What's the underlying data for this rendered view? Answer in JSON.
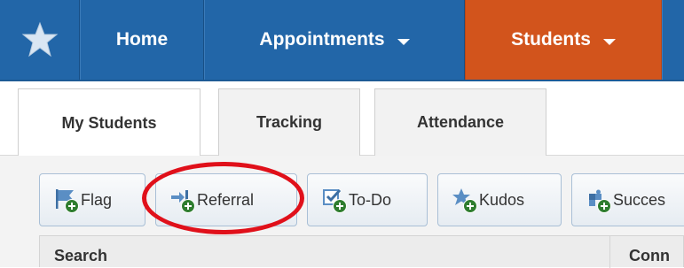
{
  "nav": {
    "items": [
      {
        "label": "Home"
      },
      {
        "label": "Appointments"
      },
      {
        "label": "Students"
      }
    ],
    "active_color": "#d2541c",
    "bar_color": "#2266a8"
  },
  "tabs": [
    {
      "label": "My Students",
      "active": true
    },
    {
      "label": "Tracking"
    },
    {
      "label": "Attendance"
    }
  ],
  "actions": [
    {
      "label": "Flag",
      "icon": "flag-icon"
    },
    {
      "label": "Referral",
      "icon": "arrow-right-icon",
      "highlighted": true
    },
    {
      "label": "To-Do",
      "icon": "checkbox-icon"
    },
    {
      "label": "Kudos",
      "icon": "star-icon"
    },
    {
      "label": "Succes",
      "icon": "puzzle-icon"
    }
  ],
  "table": {
    "columns": [
      "Search",
      "Conn"
    ]
  },
  "annotation": {
    "color": "#e0101a"
  }
}
